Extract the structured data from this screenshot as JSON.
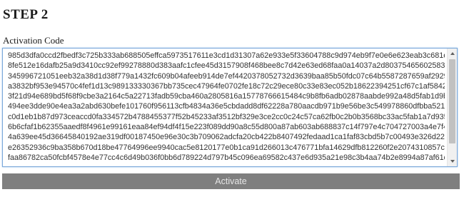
{
  "step_title": "STEP 2",
  "activation": {
    "label": "Activation Code",
    "code": "985d3dfa0ccd2fbedf3c725b333ab688505effca5973517611e3cd1d31307a62e933e5f33604788c9d974eb9f7e0e6e623eab3c681e\n8fe512e16dafb25a9d3410cc92ef99278880d383aafc1cfee45d3157908f468bee8c7d42e63ed68faa0a14037a2d803754656025830c\n345996721051eeb32a38d1d38f779a1432fc609b04afeeb914de7ef4420378052732d3639baa85b50fdc07c64b5587287659af2929\na3832bf953e94570c4fef1d13c989133330367bb735cec47964fe0702fe18c72c29ece80c33e83ec052b18622394251cf67c1af58427\n3f21d94e689bd5f68f9cbe3a2164c5a22713fadb59cba460a2805816a15778766615484c9b8fb6adb02878aabde992a48d5fab1d9b\n494ee3dde90e4ea3a2abd630befe101760f956113cfb4834a36e5cbdadd8df62228a780aacdb971b9e56be3c549978860dfbba5211\nc0d1eb1b87d973ceaccd0fa334572b4788455377f52b45233af3512bf329e3ce2cc0c24c57ca62fb0c2b0b3568bc33ac5fab1a7d935\n6b6cfaf1b62355aaedf8f4961e99161eaa84ef94df4f15e223f089dd90a8c55d800a87ab603ab688837c14f797e4c704727003a4e7f43\n4a639ee45d36645840192ae319df00187450e96e30c3b709062adcfa20cb422b8407492fedaad1ca1faf83cbd5b7c00493e326d226\ne26352936c9ba358b670d18be47764996ee9940cac5e8120177e0b1ca91d266013c476771bfa14629dfb812260f2e2074310857cce\nfaa86782ca50fcbf4578e4e77cc4c6d49b036f0bb6d789224d797b45c096ea69582c437e6d935a21e98c3b4aa74b2e8994a87af61dc"
  },
  "button": {
    "activate_label": "Activate"
  }
}
